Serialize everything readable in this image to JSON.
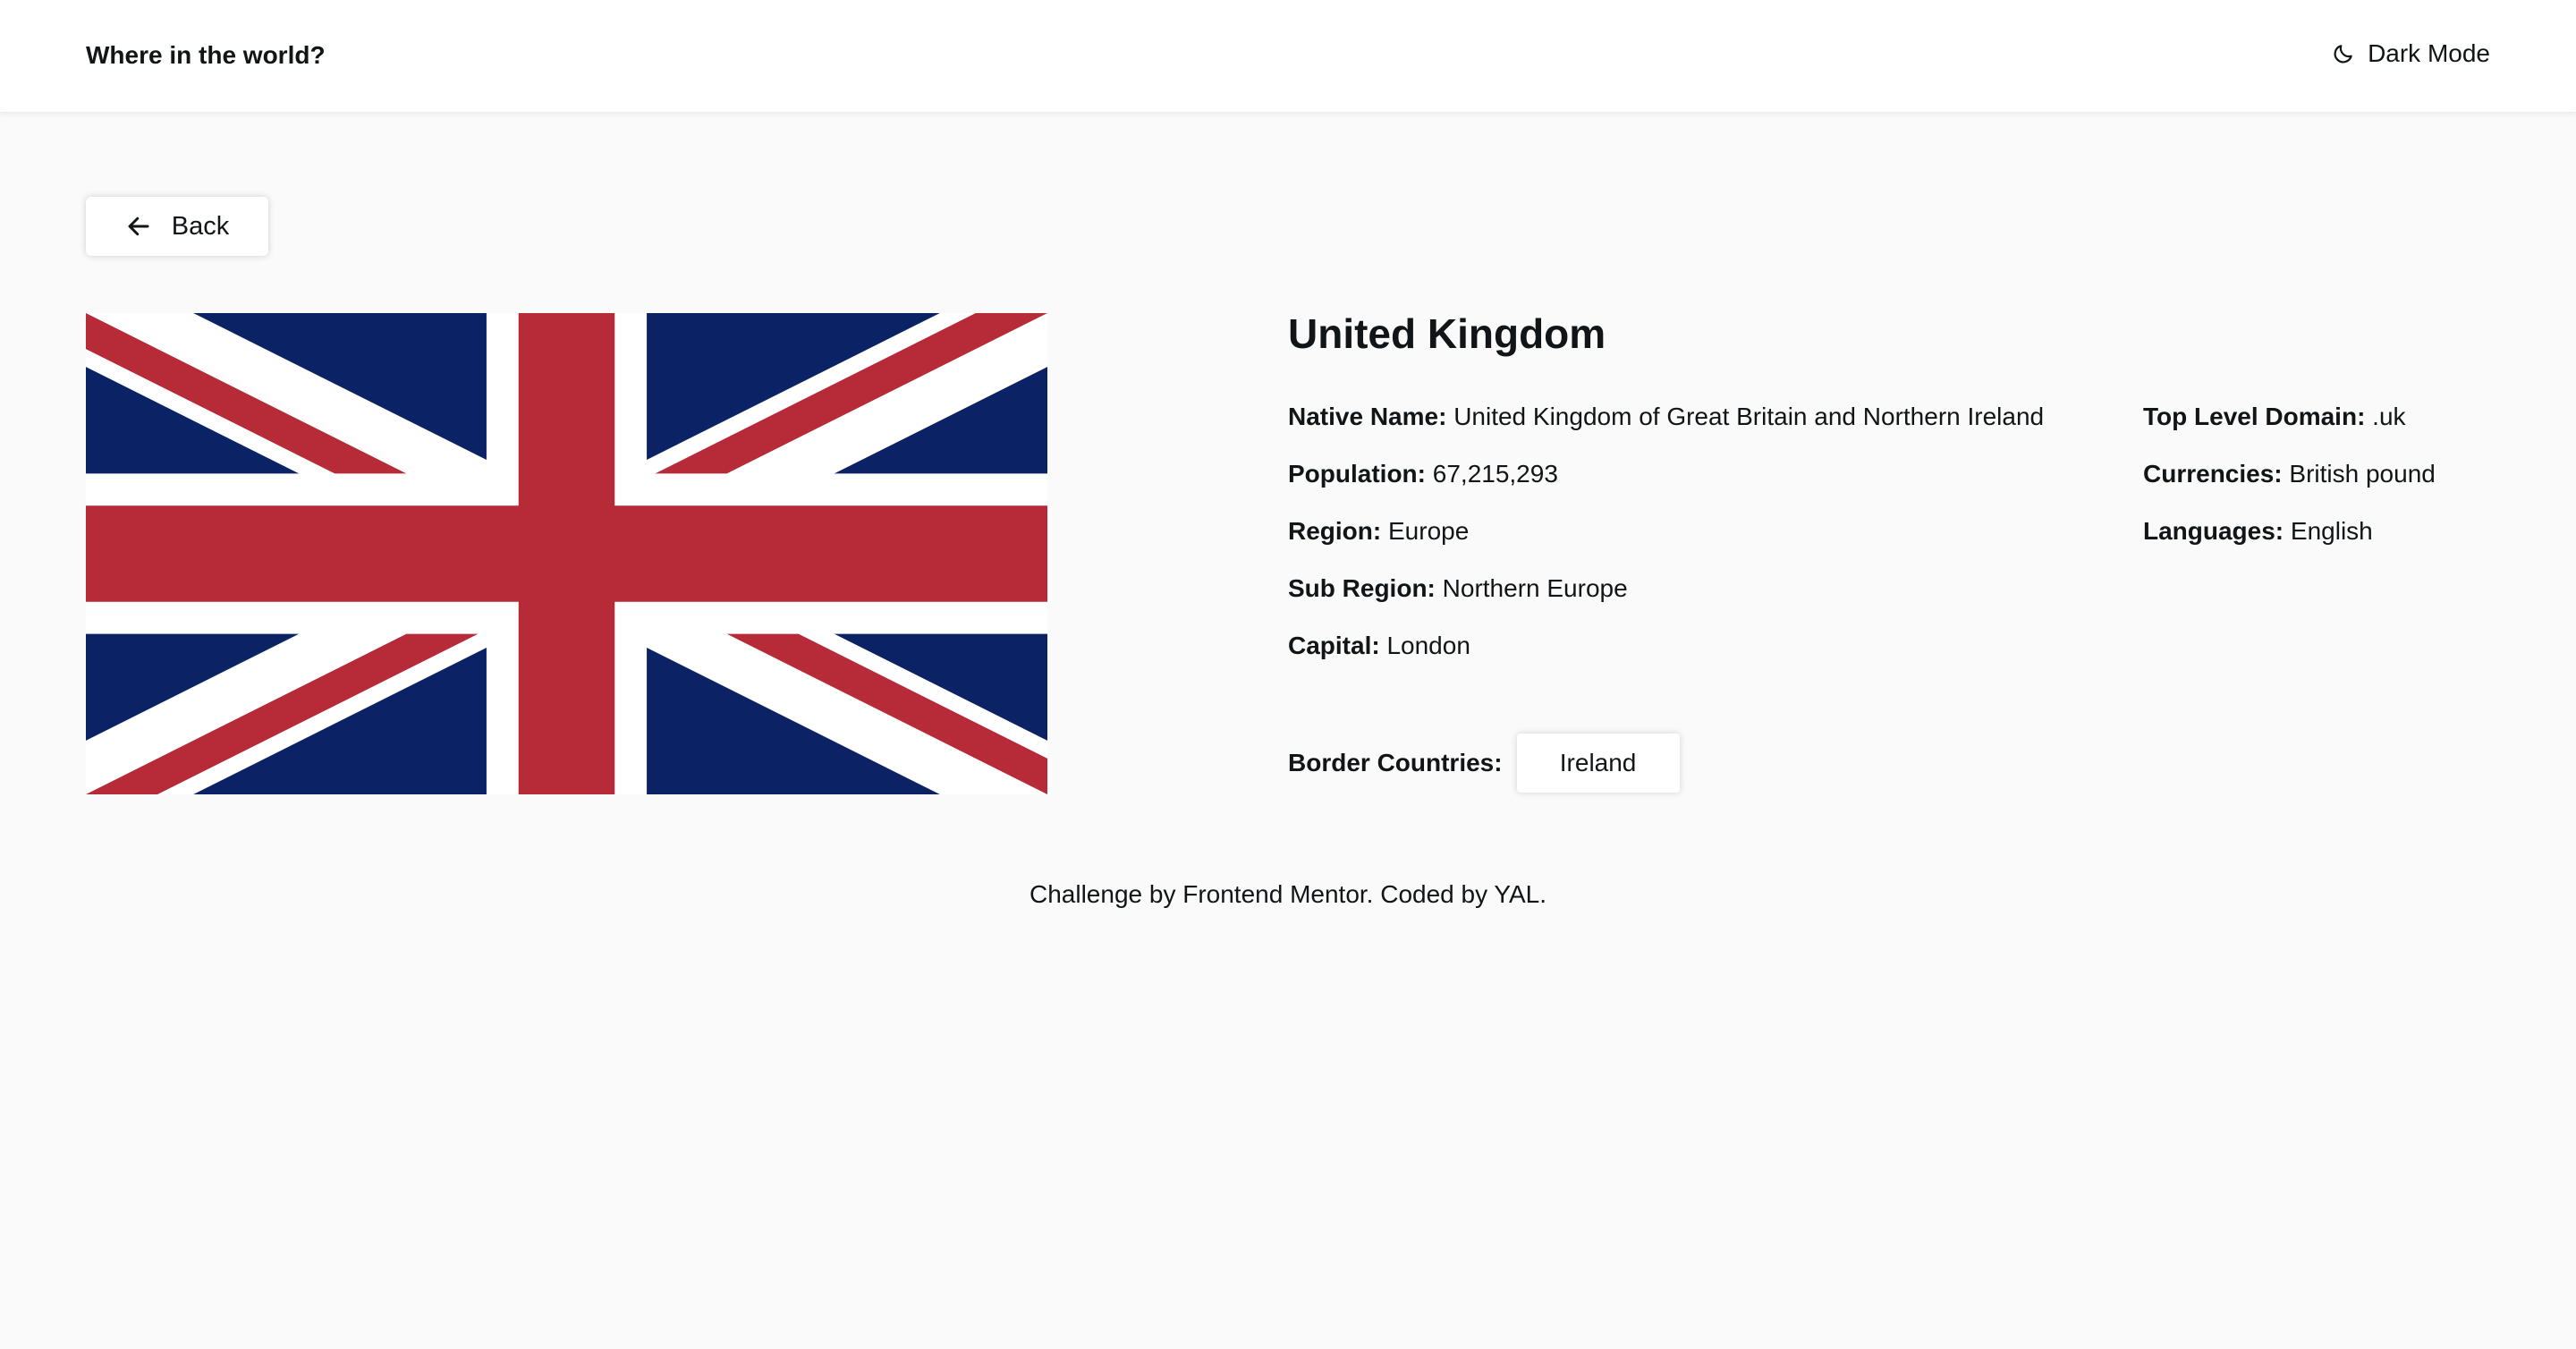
{
  "header": {
    "title": "Where in the world?",
    "dark_mode_label": "Dark Mode"
  },
  "back_label": "Back",
  "country": {
    "name": "United Kingdom",
    "flag_alt": "Flag of United Kingdom",
    "left_details": [
      {
        "label": "Native Name:",
        "value": "United Kingdom of Great Britain and Northern Ireland"
      },
      {
        "label": "Population:",
        "value": "67,215,293"
      },
      {
        "label": "Region:",
        "value": "Europe"
      },
      {
        "label": "Sub Region:",
        "value": "Northern Europe"
      },
      {
        "label": "Capital:",
        "value": "London"
      }
    ],
    "right_details": [
      {
        "label": "Top Level Domain:",
        "value": ".uk"
      },
      {
        "label": "Currencies:",
        "value": "British pound"
      },
      {
        "label": "Languages:",
        "value": "English"
      }
    ],
    "border_label": "Border Countries:",
    "borders": [
      "Ireland"
    ]
  },
  "footer": {
    "text": "Challenge by Frontend Mentor. Coded by YAL."
  },
  "colors": {
    "background": "#fafafa",
    "surface": "#ffffff",
    "text": "#111517",
    "flag_blue": "#0b2265",
    "flag_red": "#b62b37",
    "flag_white": "#ffffff"
  },
  "icons": {
    "dark_mode": "moon-icon",
    "back": "arrow-left-icon"
  }
}
